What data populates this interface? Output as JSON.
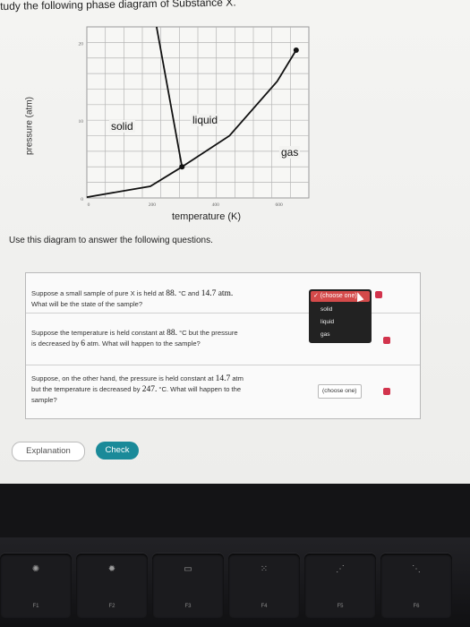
{
  "header": {
    "title": "tudy the following phase diagram of Substance X."
  },
  "diagram": {
    "y_axis_label": "pressure (atm)",
    "x_axis_label": "temperature (K)",
    "y_ticks": [
      "20",
      "10",
      "0"
    ],
    "x_ticks": [
      "0",
      "200",
      "400",
      "600"
    ],
    "region_labels": {
      "solid": "solid",
      "liquid": "liquid",
      "gas": "gas"
    }
  },
  "chart_data": {
    "type": "line",
    "xlabel": "temperature (K)",
    "ylabel": "pressure (atm)",
    "xlim": [
      0,
      700
    ],
    "ylim": [
      0,
      22
    ],
    "grid": true,
    "series": [
      {
        "points": [
          [
            0,
            0.1
          ],
          [
            200,
            1.5
          ],
          [
            300,
            4
          ]
        ]
      },
      {
        "points": [
          [
            300,
            4
          ],
          [
            220,
            22
          ]
        ]
      },
      {
        "points": [
          [
            300,
            4
          ],
          [
            450,
            8
          ],
          [
            600,
            15
          ],
          [
            660,
            19
          ]
        ]
      }
    ]
  },
  "instructions": "Use this diagram to answer the following questions.",
  "questions": [
    {
      "text_a": "Suppose a small sample of pure X is held at ",
      "temp": "88.",
      "unit1": " °C and ",
      "pressure": "14.7",
      "unit2": " atm.",
      "text_b": "What will be the state of the sample?",
      "answer": "✓ (choose one)"
    },
    {
      "text_a": "Suppose the temperature is held constant at ",
      "temp": "88.",
      "unit1": " °C but the pressure",
      "text_b": "is decreased by ",
      "amount": "6",
      "unit2": " atm. What will happen to the sample?",
      "answer": ""
    },
    {
      "text_a": "Suppose, on the other hand, the pressure is held constant at ",
      "pressure": "14.7",
      "unit1": " atm",
      "text_b": "but the temperature is decreased by ",
      "amount": "247.",
      "unit2": " °C. What will happen to the",
      "text_c": "sample?",
      "answer": "(choose one)"
    }
  ],
  "dropdown_options": [
    "solid",
    "liquid",
    "gas"
  ],
  "buttons": {
    "explanation": "Explanation",
    "check": "Check"
  },
  "keyboard": {
    "keys": [
      {
        "label": "F1",
        "icon": "brightness-down-icon"
      },
      {
        "label": "F2",
        "icon": "brightness-up-icon"
      },
      {
        "label": "F3",
        "icon": "mission-control-icon"
      },
      {
        "label": "F4",
        "icon": "launchpad-icon"
      },
      {
        "label": "F5",
        "icon": "keyboard-light-down-icon"
      },
      {
        "label": "F6",
        "icon": "keyboard-light-up-icon"
      }
    ]
  },
  "colors": {
    "check": "#1a8a99",
    "dropdown_selected": "#d44a4a",
    "alert": "#d2334c"
  }
}
